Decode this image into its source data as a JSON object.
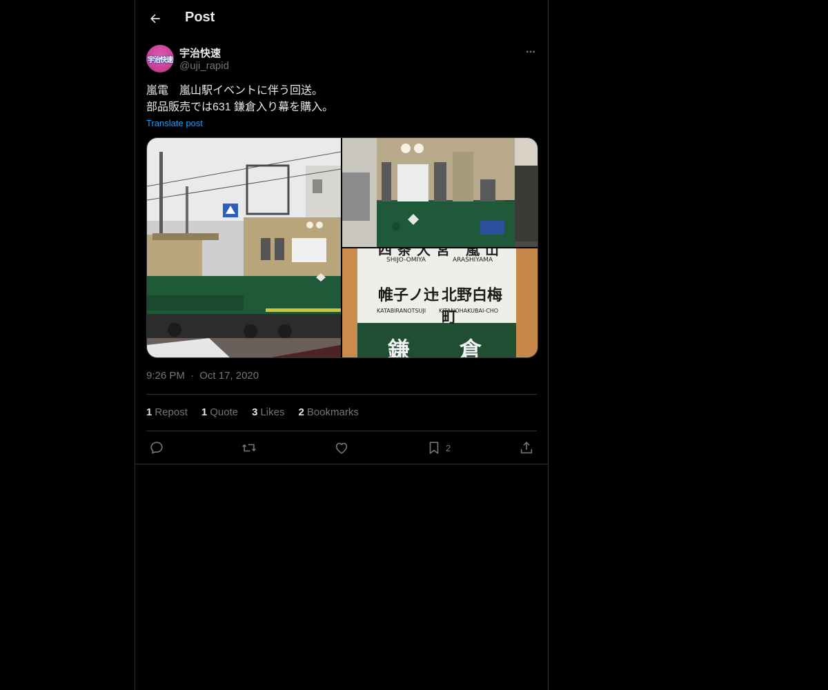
{
  "header": {
    "title": "Post",
    "back_icon": "arrow-left-icon"
  },
  "author": {
    "display_name": "宇治快速",
    "handle": "@uji_rapid",
    "avatar_text": "宇治快速",
    "avatar_color": "#c94199"
  },
  "post": {
    "lines": [
      "嵐電　嵐山駅イベントに伴う回送。",
      "部品販売では631 鎌倉入り幕を購入。"
    ],
    "translate_label": "Translate post",
    "media": [
      {
        "alt_icon": "tram-photo-icon"
      },
      {
        "alt_icon": "tram-closeup-photo-icon"
      },
      {
        "alt_icon": "destination-sign-photo-icon",
        "sign": {
          "top_line": "四条大宮 嵐山",
          "top_roman_left": "SHIJO-OMIYA",
          "top_roman_right": "ARASHIYAMA",
          "main_left": "帷子ノ辻",
          "main_right": "北野白梅町",
          "roman_left": "KATABIRANOTSUJI",
          "roman_right": "KITANOHAKUBAI-CHO",
          "bottom": "鎌　倉"
        }
      }
    ],
    "time": "9:26 PM",
    "separator": "·",
    "date": "Oct 17, 2020"
  },
  "stats": {
    "reposts": {
      "count": "1",
      "label": "Repost"
    },
    "quotes": {
      "count": "1",
      "label": "Quote"
    },
    "likes": {
      "count": "3",
      "label": "Likes"
    },
    "bookmarks": {
      "count": "2",
      "label": "Bookmarks"
    }
  },
  "actions": {
    "reply_icon": "reply-icon",
    "repost_icon": "repost-icon",
    "like_icon": "heart-icon",
    "bookmark_icon": "bookmark-icon",
    "bookmark_count": "2",
    "share_icon": "share-icon"
  },
  "colors": {
    "background": "#000000",
    "text": "#e7e9ea",
    "secondary": "#71767b",
    "link": "#1d9bf0",
    "border": "#2f3336"
  }
}
